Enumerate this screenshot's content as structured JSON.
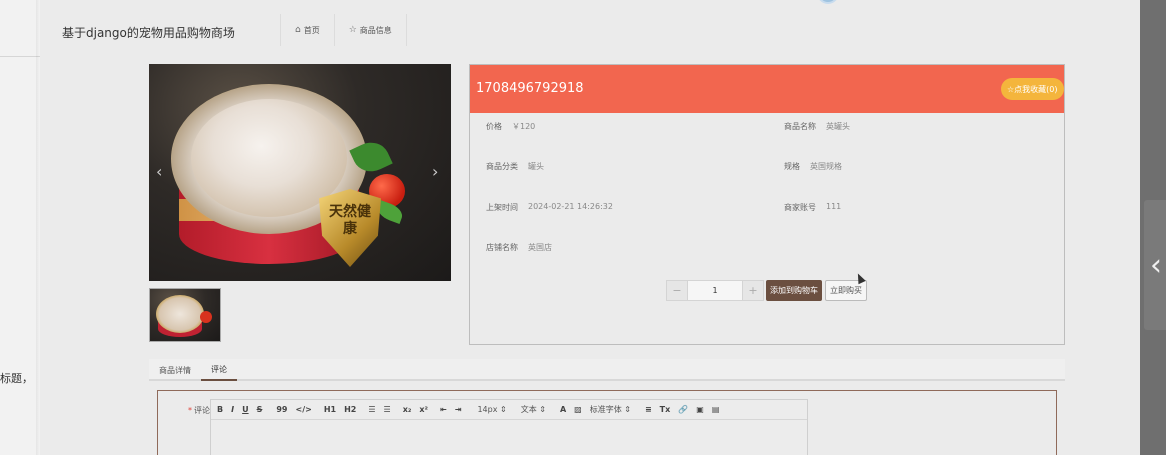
{
  "background": {
    "left_text": "标题，",
    "right_chevron_icon": "chevron-left-icon"
  },
  "header": {
    "site_title": "基于django的宠物用品购物商场",
    "nav": [
      {
        "icon": "home-icon",
        "icon_char": "⌂",
        "label": "首页"
      },
      {
        "icon": "star-icon",
        "icon_char": "☆",
        "label": "商品信息"
      }
    ]
  },
  "gallery": {
    "shield_text": "天然健康",
    "prev_icon": "‹",
    "next_icon": "›"
  },
  "product": {
    "title": "1708496792918",
    "favorite_label": "☆点我收藏(0)",
    "fields": {
      "price_label": "价格",
      "price_value": "￥120",
      "name_label": "商品名称",
      "name_value": "英罐头",
      "category_label": "商品分类",
      "category_value": "罐头",
      "spec_label": "规格",
      "spec_value": "英国规格",
      "time_label": "上架时间",
      "time_value": "2024-02-21 14:26:32",
      "account_label": "商家账号",
      "account_value": "111",
      "shop_label": "店铺名称",
      "shop_value": "英国店"
    },
    "quantity": {
      "minus": "−",
      "value": "1",
      "plus": "+"
    },
    "add_cart_label": "添加到购物车",
    "buy_now_label": "立即购买"
  },
  "tabs": [
    {
      "label": "商品详情",
      "active": false
    },
    {
      "label": "评论",
      "active": true
    }
  ],
  "comment": {
    "required_mark": "*",
    "label": "评论",
    "toolbar": {
      "bold": "B",
      "italic": "I",
      "underline": "U",
      "strike": "S",
      "quote": "99",
      "code": "</>",
      "h1": "H1",
      "h2": "H2",
      "ol": "☰",
      "ul": "☰",
      "sub": "x₂",
      "sup": "x²",
      "indent_left": "⇤",
      "indent_right": "⇥",
      "font_size": "14px",
      "text_type": "文本",
      "color": "A",
      "bg_color": "▨",
      "font_family": "标准字体",
      "align": "≡",
      "clear": "Tx",
      "link": "🔗",
      "image": "▣",
      "video": "▤"
    }
  }
}
